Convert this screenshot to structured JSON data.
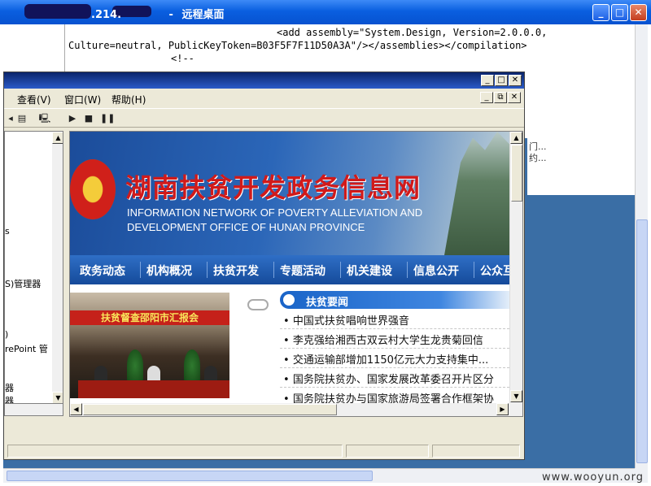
{
  "window": {
    "title": "远程桌面",
    "title_fragment": ".214.",
    "dash": "-",
    "minimize": "_",
    "maximize": "□",
    "close": "✕"
  },
  "code": {
    "line1": "<add assembly=\"System.Design, Version=2.0.0.0,",
    "line2": "Culture=neutral, PublicKeyToken=B03F5F7F11D50A3A\"/></assemblies></compilation>",
    "line3": "<!--"
  },
  "side_panel": {
    "line1": "门...",
    "line2": "约..."
  },
  "mmc": {
    "menu": [
      "查看(V)",
      "窗口(W)",
      "帮助(H)"
    ],
    "tree_items": [
      "s",
      "S)管理器",
      ")",
      "rePoint 管",
      "器",
      "器"
    ]
  },
  "site": {
    "title": "湖南扶贫开发政务信息网",
    "subtitle_line1": "INFORMATION NETWORK OF POVERTY ALLEVIATION AND",
    "subtitle_line2": "DEVELOPMENT OFFICE OF HUNAN PROVINCE",
    "nav": [
      "政务动态",
      "机构概况",
      "扶贫开发",
      "专题活动",
      "机关建设",
      "信息公开",
      "公众互"
    ],
    "photo_caption": "扶贫督查邵阳市汇报会",
    "news_header": "扶贫要闻",
    "news": [
      "中国式扶贫唱响世界强音",
      "李克强给湘西古双云村大学生龙贵菊回信",
      "交通运输部增加1150亿元大力支持集中...",
      "国务院扶贫办、国家发展改革委召开片区分",
      "国务院扶贫办与国家旅游局签署合作框架协"
    ]
  },
  "watermark": "www.wooyun.org"
}
